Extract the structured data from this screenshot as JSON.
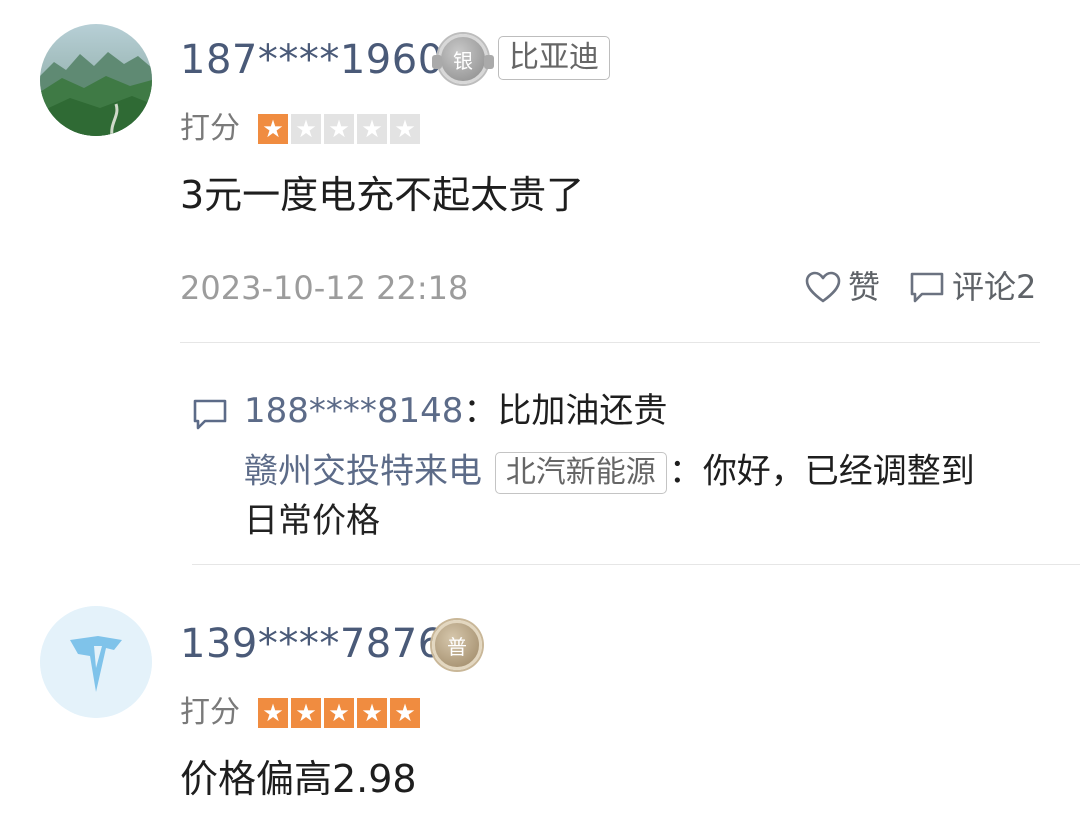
{
  "comments": [
    {
      "username": "187****1960",
      "medal": {
        "label": "银",
        "level": "silver"
      },
      "brand_tag": "比亚迪",
      "rating_label": "打分",
      "rating": 1,
      "rating_max": 5,
      "text": "3元一度电充不起太贵了",
      "timestamp": "2023-10-12 22:18",
      "like_label": "赞",
      "comment_label": "评论2",
      "replies": [
        {
          "user": "188****8148",
          "sep": "：",
          "text": "比加油还贵"
        },
        {
          "user": "赣州交投特来电",
          "tag": "北汽新能源",
          "sep": "：",
          "text_line1": "你好，已经调整到",
          "text_line2": "日常价格"
        }
      ]
    },
    {
      "username": "139****7876",
      "medal": {
        "label": "普",
        "level": "bronze"
      },
      "rating_label": "打分",
      "rating": 5,
      "rating_max": 5,
      "text": "价格偏高2.98"
    }
  ],
  "icons": {
    "star": "star-icon",
    "like": "heart-outline-icon",
    "comment": "speech-bubble-icon"
  },
  "colors": {
    "star_on": "#f08c40",
    "star_off": "#e3e3e3",
    "username": "#4a5a78",
    "reply_user": "#5c6b88"
  }
}
